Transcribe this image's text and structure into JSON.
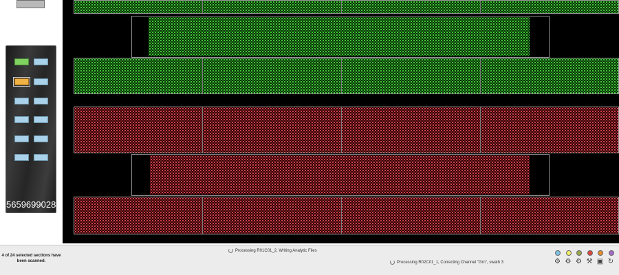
{
  "barcode": "5659699028",
  "scan_status": "4 of 24 selected sections have been scanned.",
  "processing": [
    {
      "text": "Processing R01C01_2, Writing Analytic Files"
    },
    {
      "text": "Processing R02C01_1, Correcting Channel \"Grn\", swath 3"
    }
  ],
  "indicators": [
    {
      "icon": "status-light-blue-icon",
      "color": "#7cc3e8"
    },
    {
      "icon": "status-light-yellow-icon",
      "color": "#f4f06a"
    },
    {
      "icon": "status-light-olive-icon",
      "color": "#9aaa4c"
    },
    {
      "icon": "status-light-red-icon",
      "color": "#e0453c"
    },
    {
      "icon": "status-light-orange-icon",
      "color": "#e6902c"
    },
    {
      "icon": "status-light-purple-icon",
      "color": "#a36ac7"
    }
  ],
  "tools": [
    {
      "icon": "gear-icon",
      "glyph": "⚙"
    },
    {
      "icon": "gear-icon",
      "glyph": "⚙"
    },
    {
      "icon": "gear-icon",
      "glyph": "⚙"
    },
    {
      "icon": "wrench-icon",
      "glyph": "⚒"
    },
    {
      "icon": "camera-icon",
      "glyph": "▣"
    },
    {
      "icon": "refresh-icon",
      "glyph": "↻"
    }
  ],
  "colors": {
    "green_channel": "#43d13a",
    "red_channel": "#d9404a",
    "selected_section": "#f0b245",
    "scanned_section": "#7fd25f",
    "pending_section": "#a9d2ea"
  }
}
